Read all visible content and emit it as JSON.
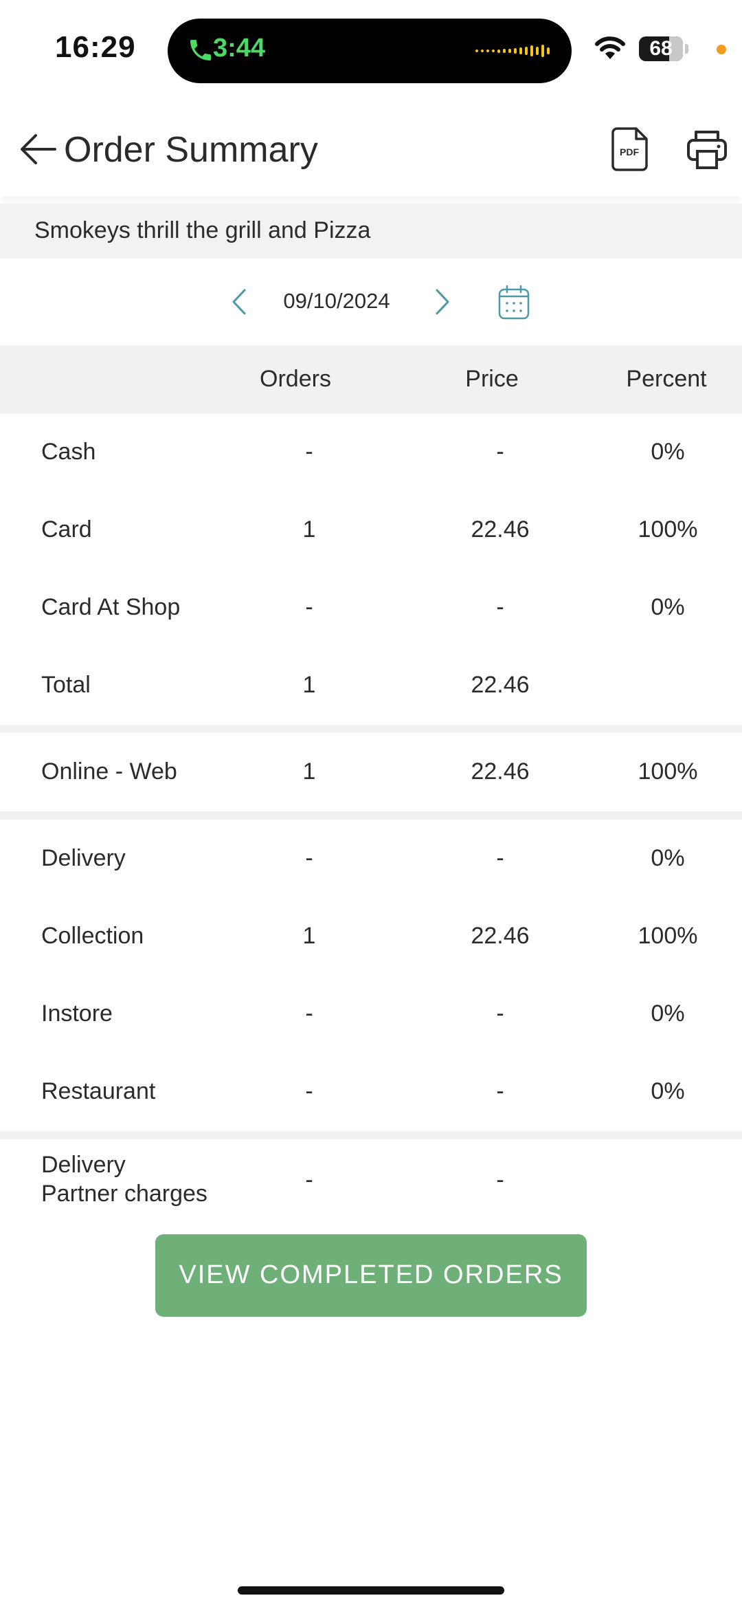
{
  "status_bar": {
    "time": "16:29",
    "call_timer": "3:44",
    "battery": "68",
    "battery_level": 0.68,
    "colors": {
      "call": "#4cd964",
      "privacy_dot": "#f39c1f"
    }
  },
  "header": {
    "title": "Order Summary",
    "pdf_label": "PDF"
  },
  "shop": {
    "name": "Smokeys thrill the grill and Pizza"
  },
  "date_nav": {
    "date": "09/10/2024"
  },
  "table": {
    "columns": {
      "orders": "Orders",
      "price": "Price",
      "percent": "Percent"
    },
    "payment_rows": [
      {
        "label": "Cash",
        "orders": "-",
        "price": "-",
        "percent": "0%"
      },
      {
        "label": "Card",
        "orders": "1",
        "price": "22.46",
        "percent": "100%"
      },
      {
        "label": "Card At Shop",
        "orders": "-",
        "price": "-",
        "percent": "0%"
      },
      {
        "label": "Total",
        "orders": "1",
        "price": "22.46",
        "percent": ""
      }
    ],
    "source_rows": [
      {
        "label": "Online - Web",
        "orders": "1",
        "price": "22.46",
        "percent": "100%"
      }
    ],
    "type_rows": [
      {
        "label": "Delivery",
        "orders": "-",
        "price": "-",
        "percent": "0%"
      },
      {
        "label": "Collection",
        "orders": "1",
        "price": "22.46",
        "percent": "100%"
      },
      {
        "label": "Instore",
        "orders": "-",
        "price": "-",
        "percent": "0%"
      },
      {
        "label": "Restaurant",
        "orders": "-",
        "price": "-",
        "percent": "0%"
      }
    ],
    "partner_row": {
      "label_line1": "Delivery",
      "label_line2": "Partner charges",
      "orders": "-",
      "price": "-"
    }
  },
  "cta": {
    "label": "VIEW COMPLETED ORDERS",
    "color": "#6faf78"
  },
  "accent": "#4a9aa6"
}
